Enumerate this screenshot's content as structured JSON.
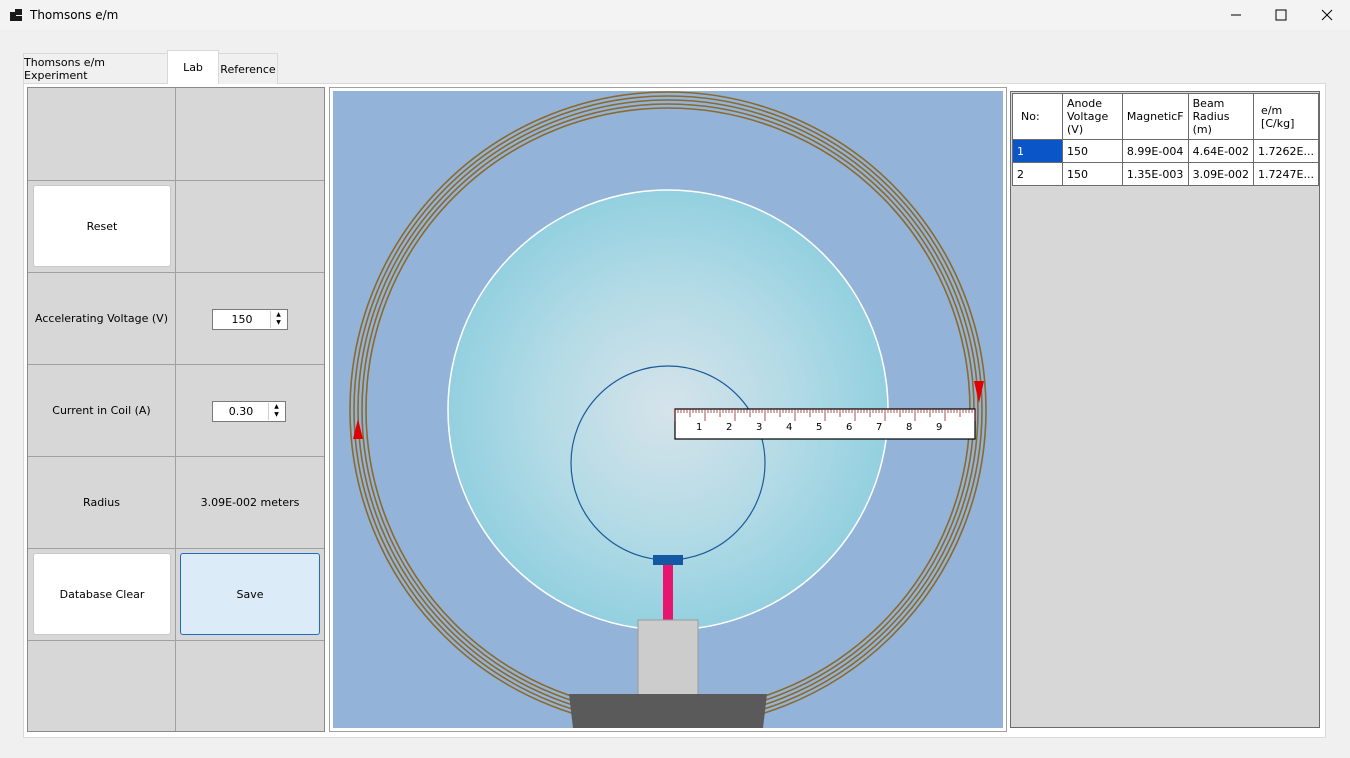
{
  "window": {
    "title": "Thomsons e/m"
  },
  "tabs": [
    {
      "label": "Thomsons e/m Experiment",
      "active": false
    },
    {
      "label": "Lab",
      "active": true
    },
    {
      "label": "Reference",
      "active": false
    }
  ],
  "controls": {
    "reset_label": "Reset",
    "voltage_label": "Accelerating Voltage (V)",
    "voltage_value": "150",
    "current_label": "Current in Coil (A)",
    "current_value": "0.30",
    "radius_label": "Radius",
    "radius_value": "3.09E-002 meters",
    "db_clear_label": "Database Clear",
    "save_label": "Save"
  },
  "ruler": {
    "ticks": [
      "1",
      "2",
      "3",
      "4",
      "5",
      "6",
      "7",
      "8",
      "9"
    ]
  },
  "table": {
    "headers": [
      "No:",
      "Anode Voltage (V)",
      "MagneticF",
      "Beam Radius (m)",
      "e/m [C/kg]"
    ],
    "rows": [
      [
        "1",
        "150",
        "8.99E-004",
        "4.64E-002",
        "1.7262E..."
      ],
      [
        "2",
        "150",
        "1.35E-003",
        "3.09E-002",
        "1.7247E..."
      ]
    ]
  },
  "colors": {
    "sim_background": "#94b3d9",
    "coil": "#8b6a2a",
    "bulb": "#a8d8e6",
    "beam": "#1a5a9a",
    "electron_gun": "#e8156e",
    "base": "#5a5a5a",
    "selection": "#0a56c9"
  }
}
